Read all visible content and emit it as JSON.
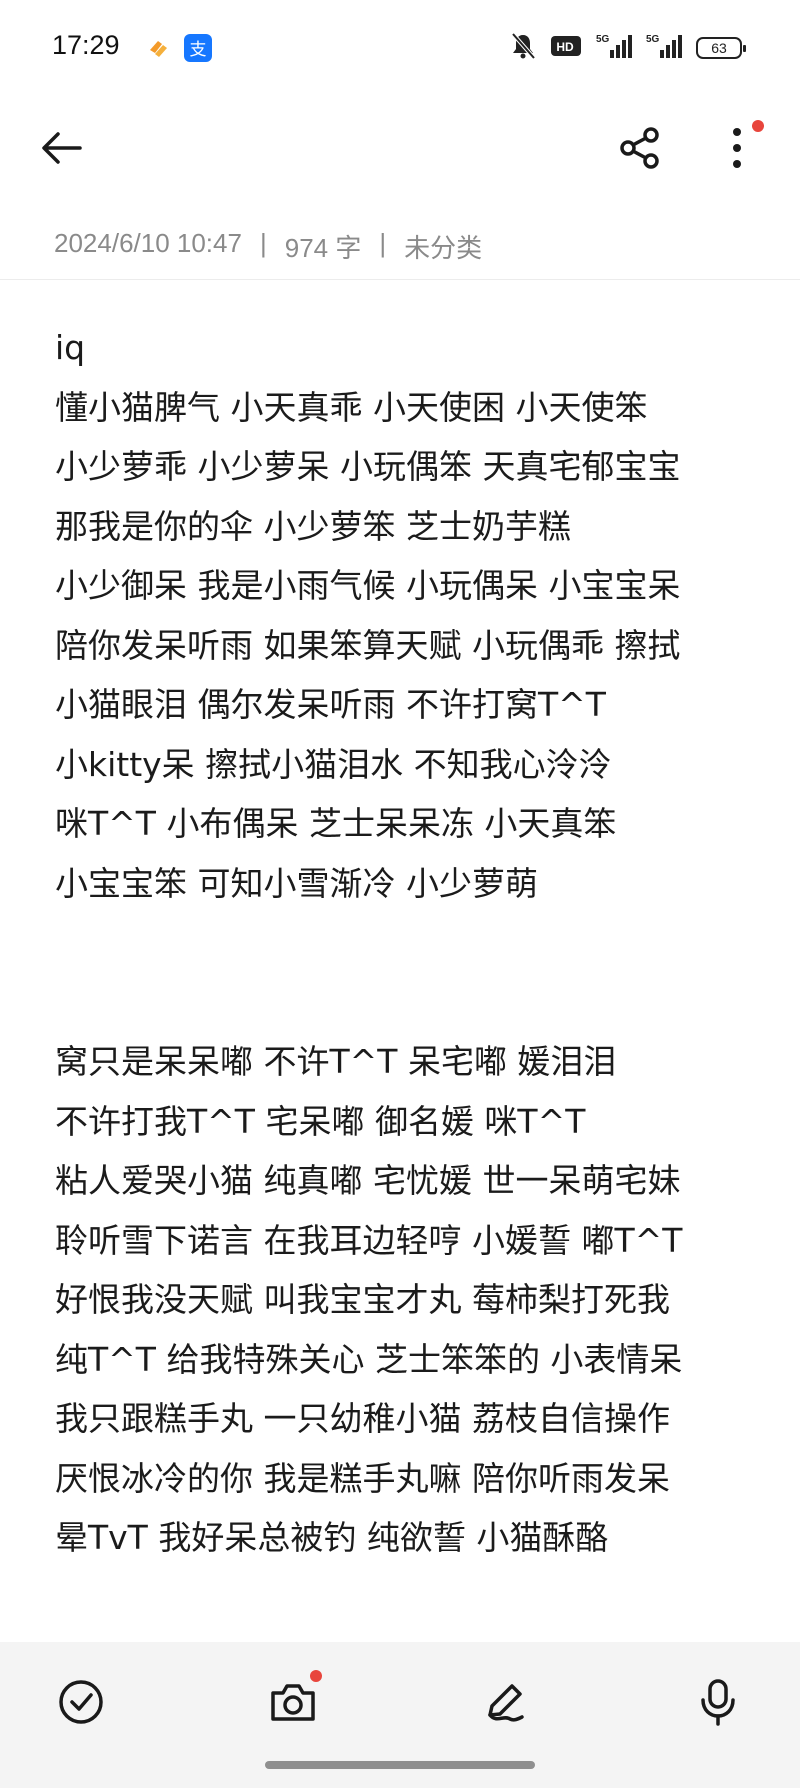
{
  "status_bar": {
    "time": "17:29",
    "battery": "63",
    "icons": [
      "app-orange-icon",
      "alipay-icon",
      "mute-bell-icon",
      "hd-icon",
      "signal-5g-icon",
      "signal-5g-icon",
      "battery-icon"
    ]
  },
  "app_bar": {
    "back_icon": "back-arrow-icon",
    "share_icon": "share-icon",
    "more_icon": "more-vertical-icon"
  },
  "meta": {
    "datetime": "2024/6/10 10:47",
    "word_count": "974 字",
    "category": "未分类",
    "separator": "|"
  },
  "note": {
    "paragraph1": [
      "iq",
      "懂小猫脾气 小天真乖 小天使困 小天使笨",
      "小少萝乖 小少萝呆 小玩偶笨 天真宅郁宝宝",
      "那我是你的伞 小少萝笨 芝士奶芋糕",
      "小少御呆 我是小雨气候 小玩偶呆 小宝宝呆",
      "陪你发呆听雨 如果笨算天赋 小玩偶乖 擦拭",
      "小猫眼泪 偶尔发呆听雨 不许打窝T^T",
      "小kitty呆 擦拭小猫泪水 不知我心泠泠",
      "咪T^T 小布偶呆 芝士呆呆冻 小天真笨",
      "小宝宝笨 可知小雪渐冷 小少萝萌"
    ],
    "paragraph2": [
      "窝只是呆呆嘟 不许T^T 呆宅嘟 媛泪泪",
      "不许打我T^T 宅呆嘟 御名媛 咪T^T",
      "粘人爱哭小猫 纯真嘟 宅忧媛 世一呆萌宅妹",
      "聆听雪下诺言 在我耳边轻哼 小媛誓 嘟T^T",
      "好恨我没天赋 叫我宝宝才丸 莓柿梨打死我",
      "纯T^T 给我特殊关心 芝士笨笨的 小表情呆",
      "我只跟糕手丸 一只幼稚小猫 荔枝自信操作",
      "厌恨冰冷的你 我是糕手丸嘛 陪你听雨发呆",
      "晕TvT 我好呆总被钓 纯欲誓 小猫酥酪"
    ]
  },
  "toolbar": {
    "items": [
      "checklist-icon",
      "camera-icon",
      "handwriting-pen-icon",
      "microphone-icon"
    ]
  },
  "colors": {
    "accent_red": "#e8453c",
    "meta_gray": "#8a8a8a",
    "toolbar_bg": "#f4f4f4",
    "text": "#1b1b1b"
  }
}
